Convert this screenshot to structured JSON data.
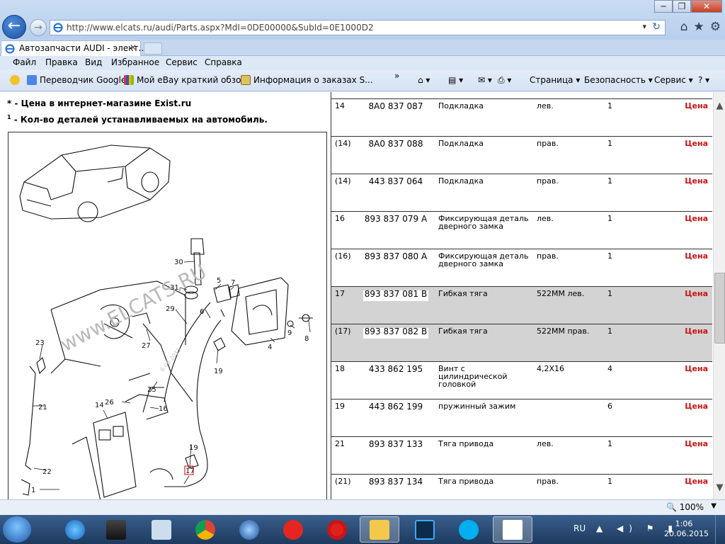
{
  "browser": {
    "url": "http://www.elcats.ru/audi/Parts.aspx?MdI=0DE00000&SubId=0E1000D2",
    "tab_title": "Автозапчасти AUDI - элект...",
    "tab_close": "✕",
    "back_glyph": "←",
    "forward_glyph": "→",
    "minimize_glyph": "─",
    "restore_glyph": "❐",
    "close_glyph": "✕",
    "refresh_glyph": "↻",
    "dropdown_glyph": "▾",
    "home_glyph": "⌂",
    "favorites_glyph": "★",
    "tools_glyph": "⚙"
  },
  "menu": [
    "Файл",
    "Правка",
    "Вид",
    "Избранное",
    "Сервис",
    "Справка"
  ],
  "favorites": {
    "items": [
      "Переводчик Google",
      "Мой eBay краткий обзор",
      "Информация о заказах  S..."
    ],
    "more": "»"
  },
  "commandbar": {
    "page": "Страница ▾",
    "safety": "Безопасность ▾",
    "service": "Сервис ▾",
    "help": "? ▾",
    "home": "⌂ ▾",
    "feeds": "▤ ▾",
    "mail": "✉ ▾",
    "print": "⎙ ▾"
  },
  "notes": {
    "line1_marker": "*",
    "line1": " - Цена в интернет-магазине Exist.ru",
    "line2_marker": "1",
    "line2": " - Кол-во деталей устанавливаемых на автомобиль."
  },
  "diagram": {
    "watermark": "www.ELCATS.RU",
    "small_watermark": "6.06.2015",
    "callouts": [
      "30",
      "31",
      "29",
      "5",
      "7",
      "6",
      "9",
      "8",
      "4",
      "27",
      "23",
      "21",
      "22",
      "1",
      "25",
      "26",
      "14",
      "16",
      "19",
      "19",
      "17"
    ]
  },
  "parts": [
    {
      "num": "14",
      "pn": "8A0 837 087",
      "name": "Подкладка",
      "note": "лев.",
      "qty": "1",
      "price": "Цена",
      "hl": false
    },
    {
      "num": "(14)",
      "pn": "8A0 837 088",
      "name": "Подкладка",
      "note": "прав.",
      "qty": "1",
      "price": "Цена",
      "hl": false
    },
    {
      "num": "(14)",
      "pn": "443 837 064",
      "name": "Подкладка",
      "note": "прав.",
      "qty": "1",
      "price": "Цена",
      "hl": false
    },
    {
      "num": "16",
      "pn": "893 837 079 A",
      "name": "Фиксирующая деталь дверного замка",
      "note": "лев.",
      "qty": "1",
      "price": "Цена",
      "hl": false
    },
    {
      "num": "(16)",
      "pn": "893 837 080 A",
      "name": "Фиксирующая деталь дверного замка",
      "note": "прав.",
      "qty": "1",
      "price": "Цена",
      "hl": false
    },
    {
      "num": "17",
      "pn": "893 837 081 B",
      "name": "Гибкая тяга",
      "note": "522MM лев.",
      "qty": "1",
      "price": "Цена",
      "hl": true
    },
    {
      "num": "(17)",
      "pn": "893 837 082 B",
      "name": "Гибкая тяга",
      "note": "522MM прав.",
      "qty": "1",
      "price": "Цена",
      "hl": true
    },
    {
      "num": "18",
      "pn": "433 862 195",
      "name": "Винт с цилиндрической головкой",
      "note": "4,2X16",
      "qty": "4",
      "price": "Цена",
      "hl": false
    },
    {
      "num": "19",
      "pn": "443 862 199",
      "name": "пружинный зажим",
      "note": "",
      "qty": "6",
      "price": "Цена",
      "hl": false
    },
    {
      "num": "21",
      "pn": "893 837 133",
      "name": "Тяга привода",
      "note": "лев.",
      "qty": "1",
      "price": "Цена",
      "hl": false
    },
    {
      "num": "(21)",
      "pn": "893 837 134",
      "name": "Тяга привода",
      "note": "прав.",
      "qty": "1",
      "price": "Цена",
      "hl": false
    }
  ],
  "status": {
    "zoom": "🔍 100%",
    "zoom_dd": "▼"
  },
  "scroll": {
    "up": "▲",
    "down": "▼"
  },
  "taskbar": {
    "lang": "RU",
    "tray": "▲ ◀) ⚑ ▮",
    "time": "1:06",
    "date": "20.06.2015"
  }
}
